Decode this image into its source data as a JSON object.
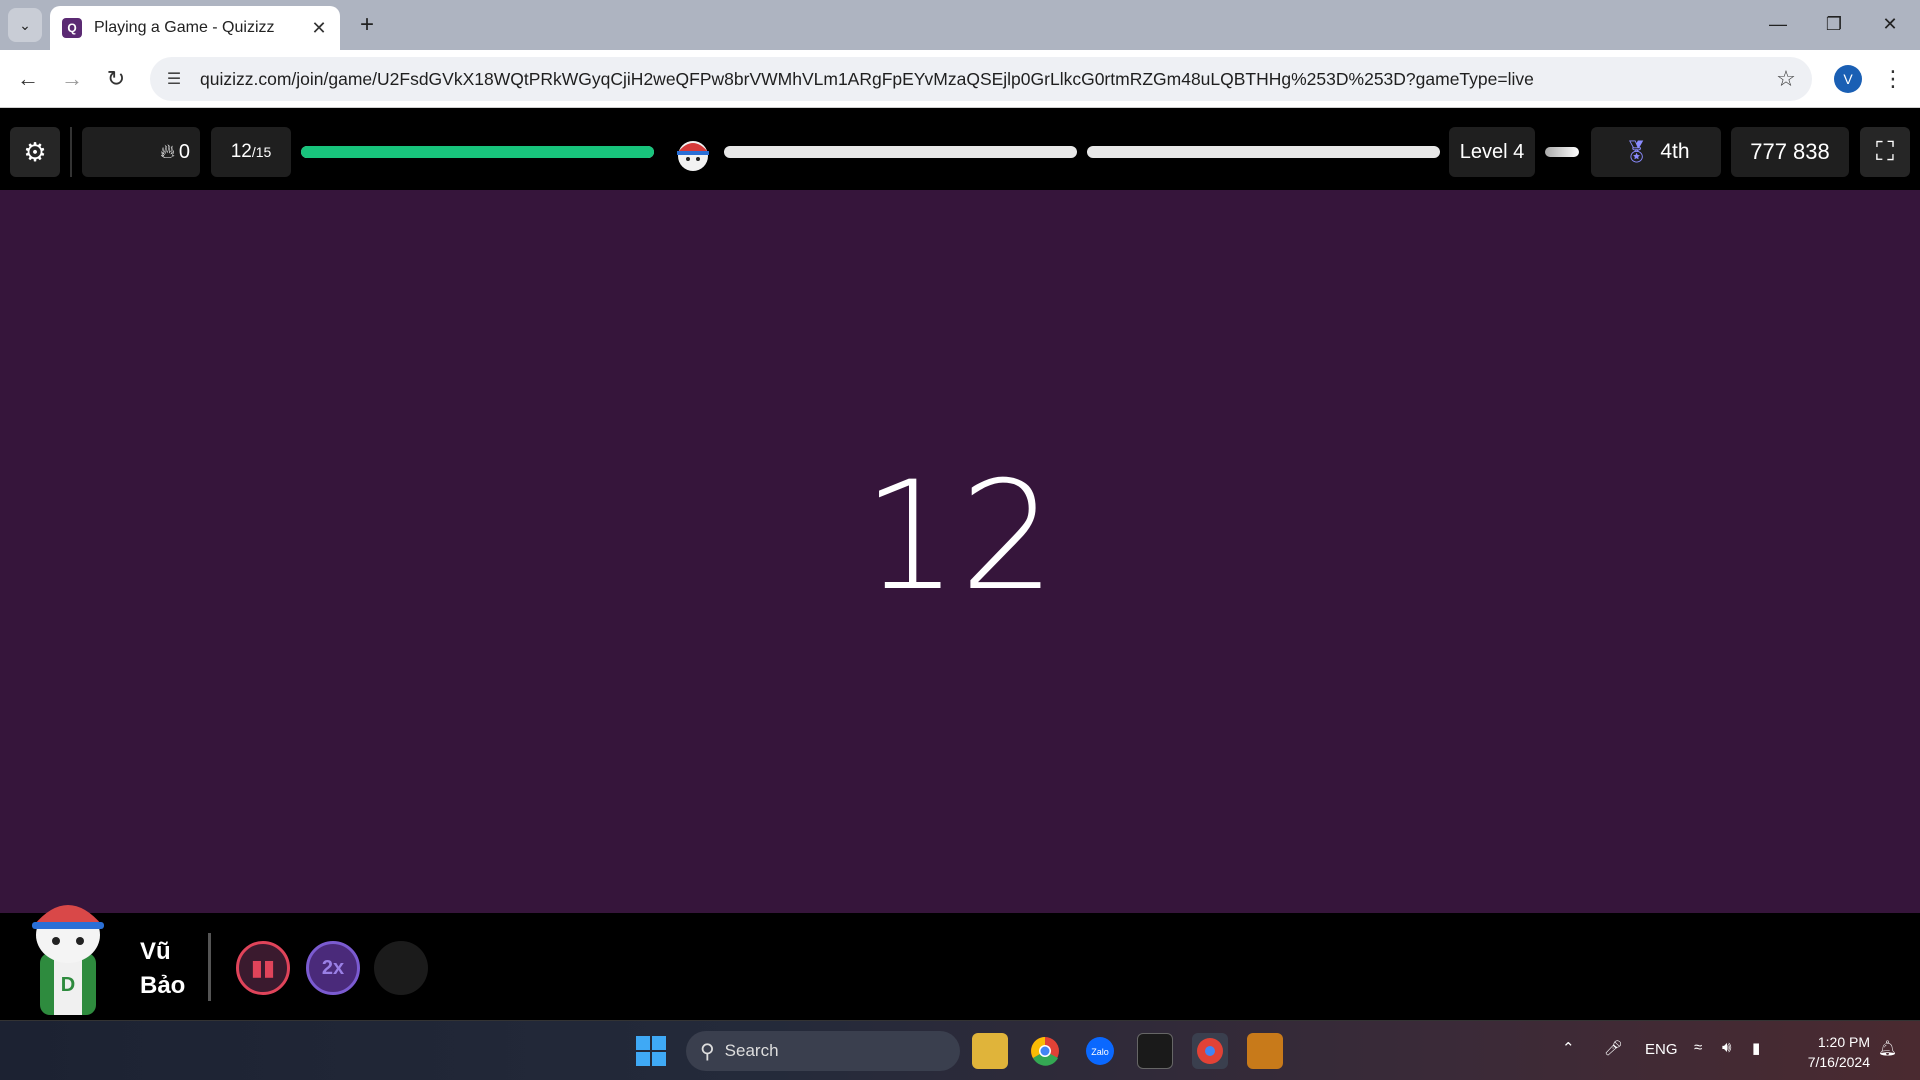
{
  "browser": {
    "tab_title": "Playing a Game - Quizizz",
    "tab_favicon": "Q",
    "url": "quizizz.com/join/game/U2FsdGVkX18WQtPRkWGyqCjiH2weQFPw8brVWMhVLm1ARgFpEYvMzaQSEjlp0GrLlkcG0rtmRZGm48uLQBTHHg%253D%253D?gameType=live",
    "profile_initial": "V"
  },
  "game": {
    "streak_count": "0",
    "question_current": "12",
    "question_total": "/15",
    "progress_fraction": 0.333,
    "level_label": "Level 4",
    "rank": "4th",
    "score": "777 838",
    "countdown": "12"
  },
  "player": {
    "first_name": "Vũ",
    "last_name": "Bảo",
    "powerups": [
      "powerup-streak-saver",
      "powerup-2x",
      "powerup-empty"
    ],
    "powerup_2x_label": "2x"
  },
  "taskbar": {
    "search_label": "Search",
    "language": "ENG",
    "time": "1:20 PM",
    "date": "7/16/2024"
  },
  "colors": {
    "stage_background": "#36153b",
    "progress_green": "#18c47c",
    "taskbar_accent": "#3fa9f5"
  }
}
